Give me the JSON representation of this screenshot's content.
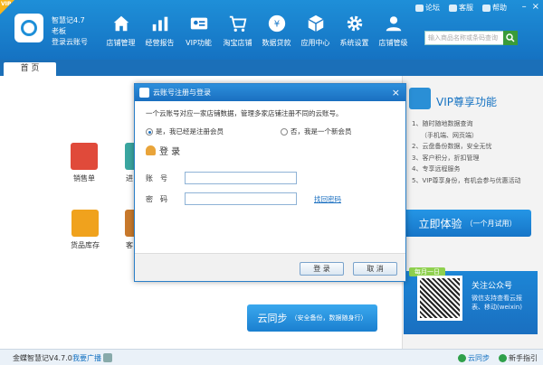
{
  "app": {
    "corner_badge": "VIP",
    "name": "智慧记4.7",
    "user": "老板",
    "cloud_account": "登录云账号"
  },
  "top_links": [
    "论坛",
    "客服",
    "帮助"
  ],
  "nav": [
    {
      "label": "店铺管理",
      "icon": "home-icon"
    },
    {
      "label": "经营报告",
      "icon": "bar-chart-icon"
    },
    {
      "label": "VIP功能",
      "icon": "vip-card-icon"
    },
    {
      "label": "淘宝店铺",
      "icon": "cart-icon"
    },
    {
      "label": "数据贷款",
      "icon": "yen-coin-icon"
    },
    {
      "label": "应用中心",
      "icon": "app-cube-icon"
    },
    {
      "label": "系统设置",
      "icon": "gear-icon"
    },
    {
      "label": "店铺管级",
      "icon": "person-icon"
    }
  ],
  "search": {
    "placeholder": "输入商品名称或条码查询"
  },
  "tabs": [
    {
      "label": "首 页"
    }
  ],
  "shortcuts": [
    {
      "label": "销售单",
      "color": "#e04a3a"
    },
    {
      "label": "进",
      "color": "#3aa6a0"
    },
    {
      "label": "货品库存",
      "color": "#f0a21d"
    },
    {
      "label": "客",
      "color": "#c8792c"
    }
  ],
  "vip": {
    "title": "VIP尊享功能",
    "items": [
      "1、随时随地数据查询",
      "（手机端、网页端）",
      "2、云盘备份数据，安全无忧",
      "3、客户积分，折扣管理",
      "4、专享远程服务",
      "5、VIP尊享身份，有机会参与优惠活动"
    ],
    "trial_label": "立即体验",
    "trial_sub": "（一个月试用）"
  },
  "wechat": {
    "tag": "每月一日",
    "title": "关注公众号",
    "desc": "微信支持查看云报表、移动(weixin)"
  },
  "sync": {
    "label": "云同步",
    "sub": "（安全备份，数据随身行）"
  },
  "status": {
    "version": "金蝶智慧记V4.7.0",
    "broadcast": "我要广播",
    "sync": "云同步",
    "guide": "新手指引"
  },
  "dialog": {
    "title": "云账号注册与登录",
    "close": "×",
    "desc": "一个云账号对应一家店铺数据，管理多家店铺注册不同的云账号。",
    "radio_registered": "是，我已经是注册会员",
    "radio_new": "否，我是一个新会员",
    "login_heading": "登 录",
    "account_label": "账号",
    "password_label": "密码",
    "account_value": "",
    "password_value": "",
    "forgot_password": "找回密码",
    "login_button": "登 录",
    "cancel_button": "取 消"
  }
}
